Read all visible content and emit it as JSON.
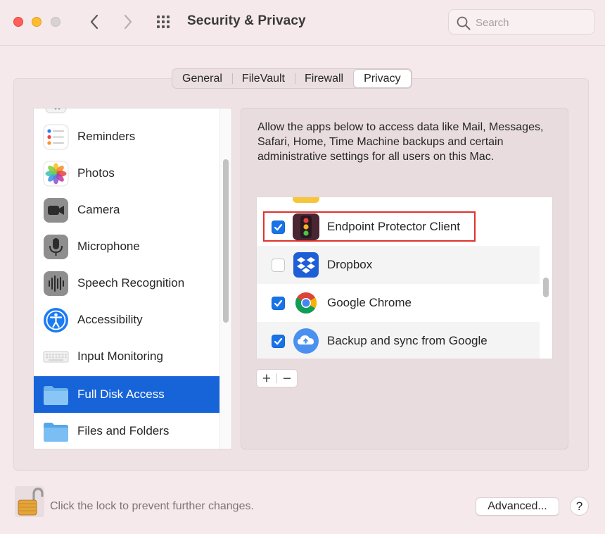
{
  "window": {
    "title": "Security & Privacy",
    "search_placeholder": "Search"
  },
  "tabs": [
    {
      "label": "General",
      "active": false
    },
    {
      "label": "FileVault",
      "active": false
    },
    {
      "label": "Firewall",
      "active": false
    },
    {
      "label": "Privacy",
      "active": true
    }
  ],
  "sidebar": {
    "items": [
      {
        "label": "Reminders",
        "icon": "reminders-icon",
        "selected": false
      },
      {
        "label": "Photos",
        "icon": "photos-icon",
        "selected": false
      },
      {
        "label": "Camera",
        "icon": "camera-icon",
        "selected": false
      },
      {
        "label": "Microphone",
        "icon": "microphone-icon",
        "selected": false
      },
      {
        "label": "Speech Recognition",
        "icon": "speech-recognition-icon",
        "selected": false
      },
      {
        "label": "Accessibility",
        "icon": "accessibility-icon",
        "selected": false
      },
      {
        "label": "Input Monitoring",
        "icon": "keyboard-icon",
        "selected": false
      },
      {
        "label": "Full Disk Access",
        "icon": "folder-icon",
        "selected": true
      },
      {
        "label": "Files and Folders",
        "icon": "folder-icon",
        "selected": false
      }
    ]
  },
  "main": {
    "description": "Allow the apps below to access data like Mail, Messages, Safari, Home, Time Machine backups and certain administrative settings for all users on this Mac.",
    "apps": [
      {
        "label": "Endpoint Protector Client",
        "icon": "endpoint-protector-icon",
        "checked": true,
        "highlighted": true
      },
      {
        "label": "Dropbox",
        "icon": "dropbox-icon",
        "checked": false,
        "highlighted": false
      },
      {
        "label": "Google Chrome",
        "icon": "chrome-icon",
        "checked": true,
        "highlighted": false
      },
      {
        "label": "Backup and sync from Google",
        "icon": "google-backup-icon",
        "checked": true,
        "highlighted": false
      }
    ],
    "add_label": "+",
    "remove_label": "−"
  },
  "footer": {
    "lock_text": "Click the lock to prevent further changes.",
    "advanced_label": "Advanced...",
    "help_label": "?"
  },
  "colors": {
    "accent": "#1764d9",
    "checkbox": "#1872e8",
    "highlight": "#e0322e",
    "window_bg": "#f5e9ec"
  }
}
